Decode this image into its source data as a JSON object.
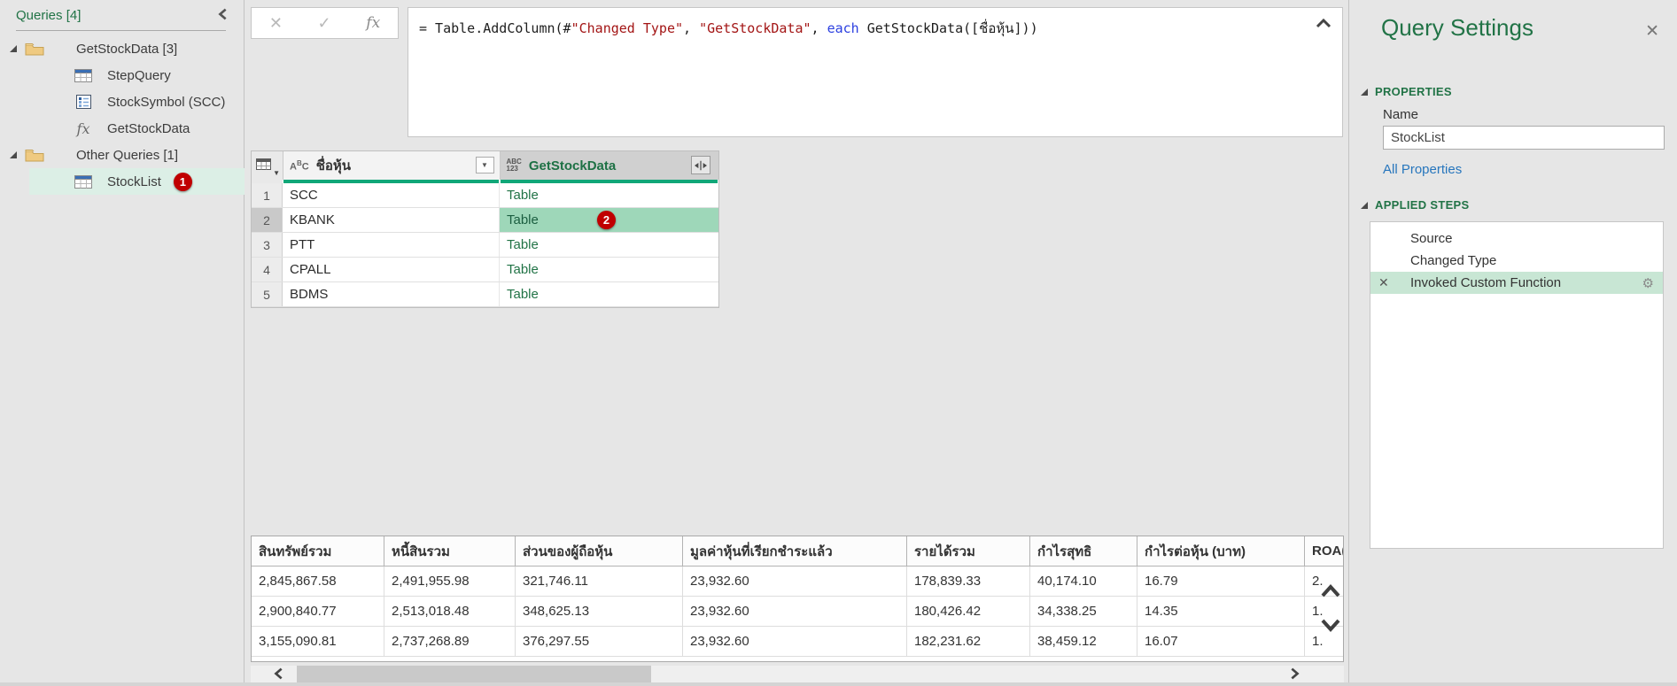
{
  "sidebar": {
    "header": "Queries [4]",
    "items": [
      {
        "type": "folder",
        "label": "GetStockData [3]",
        "indent": 1,
        "expanded": true
      },
      {
        "type": "table",
        "label": "StepQuery",
        "indent": 2
      },
      {
        "type": "parameter",
        "label": "StockSymbol (SCC)",
        "indent": 2
      },
      {
        "type": "function",
        "label": "GetStockData",
        "indent": 2
      },
      {
        "type": "folder",
        "label": "Other Queries [1]",
        "indent": 1,
        "expanded": true
      },
      {
        "type": "table",
        "label": "StockList",
        "indent": 2,
        "selected": true,
        "badge": "1"
      }
    ]
  },
  "formula_bar": {
    "segments": [
      {
        "text": "= Table.AddColumn(#",
        "type": "plain"
      },
      {
        "text": "\"Changed Type\"",
        "type": "string"
      },
      {
        "text": ", ",
        "type": "plain"
      },
      {
        "text": "\"GetStockData\"",
        "type": "string"
      },
      {
        "text": ", ",
        "type": "plain"
      },
      {
        "text": "each",
        "type": "keyword"
      },
      {
        "text": " GetStockData([ชื่อหุ้น]))",
        "type": "plain"
      }
    ]
  },
  "data_table": {
    "columns": [
      {
        "name": "ชื่อหุ้น",
        "type_icon": "ABC"
      },
      {
        "name": "GetStockData",
        "type_icon_top": "ABC",
        "type_icon_bottom": "123",
        "selected": true
      }
    ],
    "rows": [
      {
        "n": "1",
        "cells": [
          "SCC",
          "Table"
        ]
      },
      {
        "n": "2",
        "cells": [
          "KBANK",
          "Table"
        ],
        "selected": true,
        "badge": "2"
      },
      {
        "n": "3",
        "cells": [
          "PTT",
          "Table"
        ]
      },
      {
        "n": "4",
        "cells": [
          "CPALL",
          "Table"
        ]
      },
      {
        "n": "5",
        "cells": [
          "BDMS",
          "Table"
        ]
      }
    ]
  },
  "preview_table": {
    "columns": [
      "สินทรัพย์รวม",
      "หนี้สินรวม",
      "ส่วนของผู้ถือหุ้น",
      "มูลค่าหุ้นที่เรียกชำระแล้ว",
      "รายได้รวม",
      "กำไรสุทธิ",
      "กำไรต่อหุ้น (บาท)",
      "ROA("
    ],
    "rows": [
      [
        "2,845,867.58",
        "2,491,955.98",
        "321,746.11",
        "23,932.60",
        "178,839.33",
        "40,174.10",
        "16.79",
        "2."
      ],
      [
        "2,900,840.77",
        "2,513,018.48",
        "348,625.13",
        "23,932.60",
        "180,426.42",
        "34,338.25",
        "14.35",
        "1."
      ],
      [
        "3,155,090.81",
        "2,737,268.89",
        "376,297.55",
        "23,932.60",
        "182,231.62",
        "38,459.12",
        "16.07",
        "1."
      ]
    ]
  },
  "settings_panel": {
    "title": "Query Settings",
    "properties_header": "PROPERTIES",
    "name_label": "Name",
    "name_value": "StockList",
    "all_properties_link": "All Properties",
    "applied_steps_header": "APPLIED STEPS",
    "steps": [
      {
        "label": "Source"
      },
      {
        "label": "Changed Type"
      },
      {
        "label": "Invoked Custom Function",
        "selected": true,
        "deletable": true,
        "has_settings": true
      }
    ]
  },
  "icons": {
    "cancel": "✕",
    "check": "✓",
    "fx": "fx",
    "close": "✕",
    "gear": "⚙",
    "delete_step": "✕",
    "filter_caret": "▼",
    "corner_caret": "▼"
  },
  "colors": {
    "accent_green": "#217346",
    "quality_bar": "#10a778",
    "selected_cell_green": "#9ed7b9",
    "selected_step_green": "#c8e6d4",
    "selected_sidebar_green": "#dcefe6",
    "badge_red": "#c00000",
    "link_blue": "#2776bd",
    "formula_string_red": "#a31515",
    "formula_keyword_blue": "#2b3fe0"
  }
}
